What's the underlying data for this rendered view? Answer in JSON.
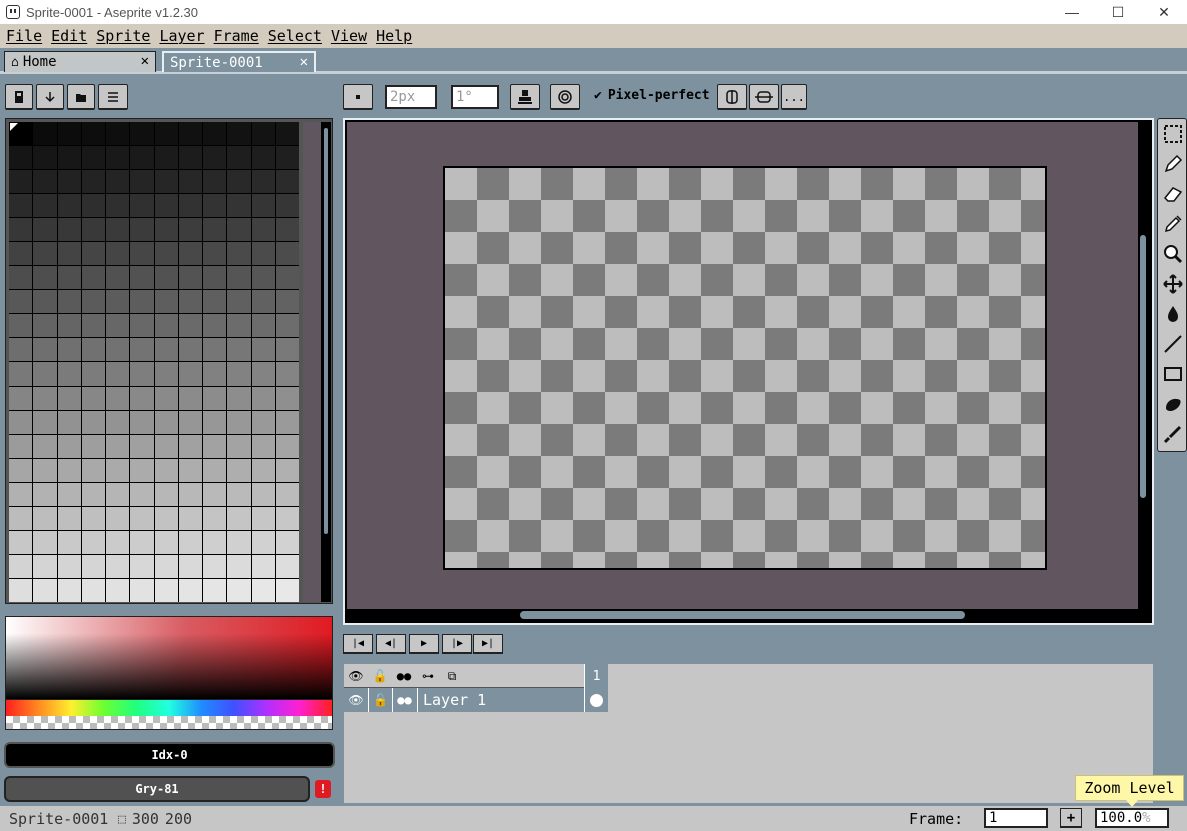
{
  "window": {
    "title": "Sprite-0001 - Aseprite v1.2.30",
    "minimize": "—",
    "maximize": "☐",
    "close": "✕"
  },
  "menu": {
    "items": [
      "File",
      "Edit",
      "Sprite",
      "Layer",
      "Frame",
      "Select",
      "View",
      "Help"
    ]
  },
  "tabs": [
    {
      "label": "Home",
      "close": "✕"
    },
    {
      "label": "Sprite-0001",
      "close": "✕"
    }
  ],
  "palette_toolbar": {
    "icons": [
      "lock-icon",
      "sort-icon",
      "presets-icon",
      "options-icon"
    ]
  },
  "tool_options": {
    "brush_size": "2px",
    "brush_angle": "1°",
    "pixel_perfect_label": "Pixel-perfect",
    "pixel_perfect_checked": true,
    "more": "..."
  },
  "colors": {
    "idx_label": "Idx-0",
    "gry_label": "Gry-81",
    "warning": "!"
  },
  "canvas": {
    "width": "300",
    "height": "200"
  },
  "timeline": {
    "frame_header": "1",
    "layers": [
      {
        "name": "Layer 1"
      }
    ]
  },
  "status": {
    "sprite_name": "Sprite-0001",
    "size_w": "300",
    "size_h": "200",
    "frame_label": "Frame:",
    "frame_value": "1",
    "zoom_value": "100.0",
    "zoom_suffix": "%",
    "zoom_tooltip": "Zoom Level"
  }
}
